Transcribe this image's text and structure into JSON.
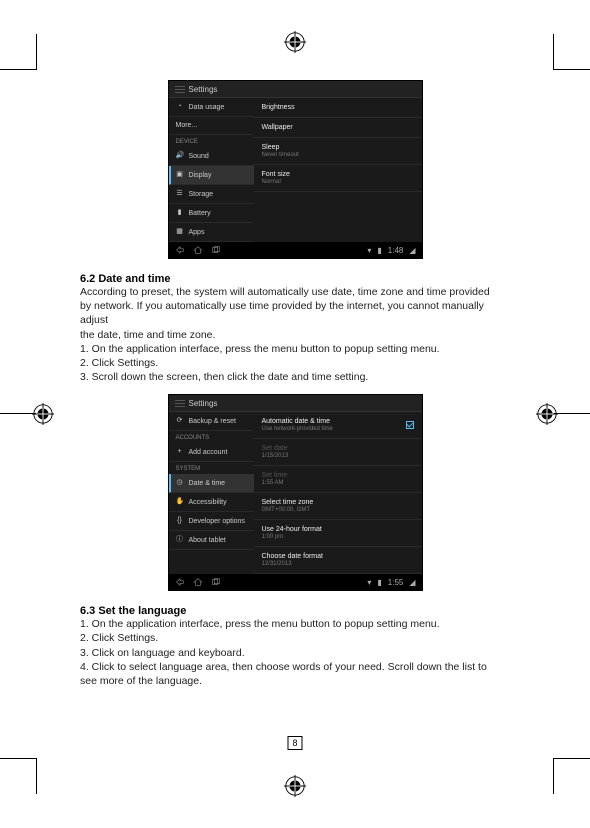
{
  "page_number": "8",
  "section_62": {
    "heading": "6.2  Date and time",
    "p1": "According to preset, the system will automatically use date, time zone and time provided",
    "p2": "by network. If you automatically use time provided by the internet, you cannot manually adjust",
    "p3": "the date, time and time zone.",
    "p4": "1. On the  application  interface, press the menu button to popup setting menu.",
    "p5": "2. Click Settings.",
    "p6": "3. Scroll down the screen, then click the date and time setting."
  },
  "section_63": {
    "heading": "6.3  Set the language",
    "p1": "1. On the application interface, press the menu button to popup setting menu.",
    "p2": "2. Click Settings.",
    "p3": "3. Click on language and keyboard.",
    "p4": "4. Click to select language area, then choose words of your need. Scroll down the list to",
    "p5": "see more of the language."
  },
  "screenshot1": {
    "title": "Settings",
    "left": {
      "data_usage": "Data usage",
      "more": "More...",
      "device_label": "DEVICE",
      "sound": "Sound",
      "display": "Display",
      "storage": "Storage",
      "battery": "Battery",
      "apps": "Apps"
    },
    "right": {
      "brightness": "Brightness",
      "wallpaper": "Wallpaper",
      "sleep": "Sleep",
      "sleep_sub": "Never timeout",
      "font_size": "Font size",
      "font_size_sub": "Normal"
    },
    "clock": "1:48"
  },
  "screenshot2": {
    "title": "Settings",
    "left": {
      "backup": "Backup & reset",
      "accounts_label": "ACCOUNTS",
      "add_account": "Add account",
      "system_label": "SYSTEM",
      "date_time": "Date & time",
      "accessibility": "Accessibility",
      "dev_options": "Developer options",
      "about": "About tablet"
    },
    "right": {
      "auto": "Automatic date & time",
      "auto_sub": "Use network-provided time",
      "set_date": "Set date",
      "set_date_sub": "1/15/2013",
      "set_time": "Set time",
      "set_time_sub": "1:55 AM",
      "tz": "Select time zone",
      "tz_sub": "GMT+00:00, GMT",
      "h24": "Use 24-hour format",
      "h24_sub": "1:00 pm",
      "date_fmt": "Choose date format",
      "date_fmt_sub": "12/31/2013"
    },
    "clock": "1:55"
  }
}
